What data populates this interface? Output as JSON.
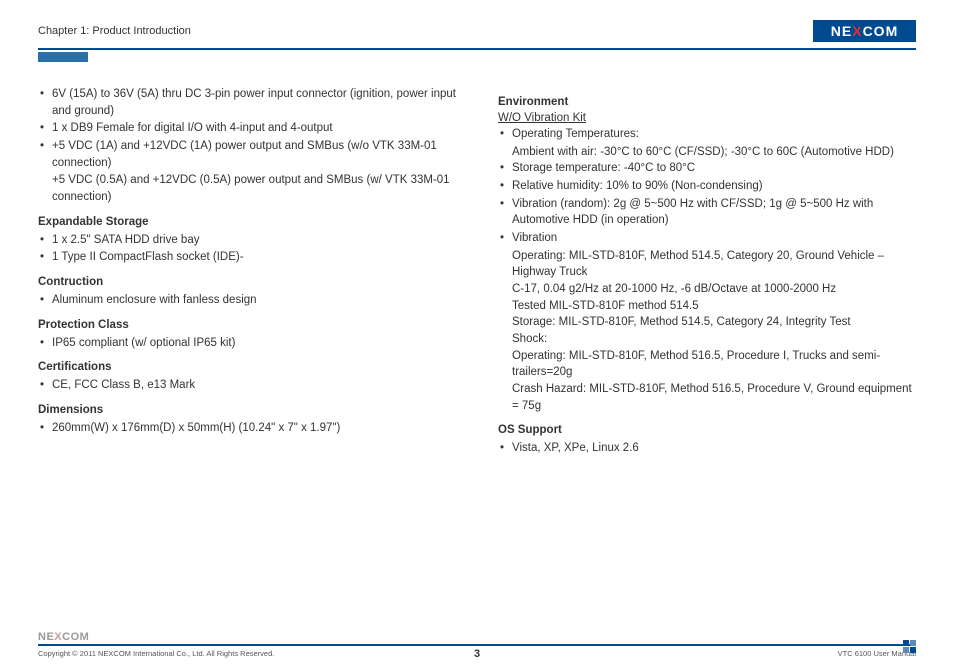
{
  "header": {
    "chapter": "Chapter 1: Product Introduction",
    "logo_ne": "NE",
    "logo_x": "X",
    "logo_com": "COM"
  },
  "left_column": {
    "power_items": [
      "6V (15A) to 36V (5A) thru DC 3-pin power input connector (ignition, power input and ground)",
      "1 x DB9 Female for digital I/O with 4-input and 4-output",
      "+5 VDC (1A) and +12VDC (1A) power output and SMBus (w/o VTK 33M-01 connection)"
    ],
    "power_sub": "+5 VDC (0.5A) and +12VDC (0.5A) power output and SMBus (w/ VTK 33M-01 connection)",
    "storage_title": "Expandable Storage",
    "storage_items": [
      "1 x 2.5\" SATA HDD drive bay",
      "1 Type II CompactFlash socket (IDE)-"
    ],
    "construction_title": "Contruction",
    "construction_items": [
      "Aluminum enclosure with fanless design"
    ],
    "protection_title": "Protection Class",
    "protection_items": [
      "IP65 compliant (w/ optional IP65 kit)"
    ],
    "cert_title": "Certifications",
    "cert_items": [
      "CE, FCC Class B, e13 Mark"
    ],
    "dim_title": "Dimensions",
    "dim_items": [
      "260mm(W) x 176mm(D) x 50mm(H) (10.24\" x 7\" x 1.97\")"
    ]
  },
  "right_column": {
    "env_title": "Environment",
    "vibration_kit": "W/O Vibration Kit",
    "env_items": [
      "Operating Temperatures:",
      "Storage temperature: -40°C to 80°C",
      "Relative humidity: 10% to 90% (Non-condensing)",
      "Vibration (random): 2g @ 5~500 Hz with CF/SSD; 1g @ 5~500 Hz with Automotive HDD (in operation)",
      "Vibration"
    ],
    "env_sub0": "Ambient with air: -30°C to 60°C (CF/SSD); -30°C to 60C (Automotive HDD)",
    "env_sub_vib": [
      "Operating: MIL-STD-810F, Method 514.5, Category 20, Ground Vehicle – Highway Truck",
      "C-17, 0.04 g2/Hz at 20-1000 Hz, -6 dB/Octave at 1000-2000 Hz",
      "Tested MIL-STD-810F method 514.5",
      "Storage: MIL-STD-810F, Method 514.5, Category 24, Integrity Test",
      "Shock:",
      "Operating: MIL-STD-810F, Method 516.5, Procedure I, Trucks and semi-trailers=20g",
      "Crash Hazard: MIL-STD-810F, Method 516.5, Procedure V, Ground equipment = 75g"
    ],
    "os_title": "OS Support",
    "os_items": [
      "Vista, XP, XPe, Linux 2.6"
    ]
  },
  "footer": {
    "copyright": "Copyright © 2011 NEXCOM International Co., Ltd. All Rights Reserved.",
    "page": "3",
    "manual": "VTC 6100 User Manual",
    "logo_ne": "NE",
    "logo_x": "X",
    "logo_com": "COM"
  }
}
